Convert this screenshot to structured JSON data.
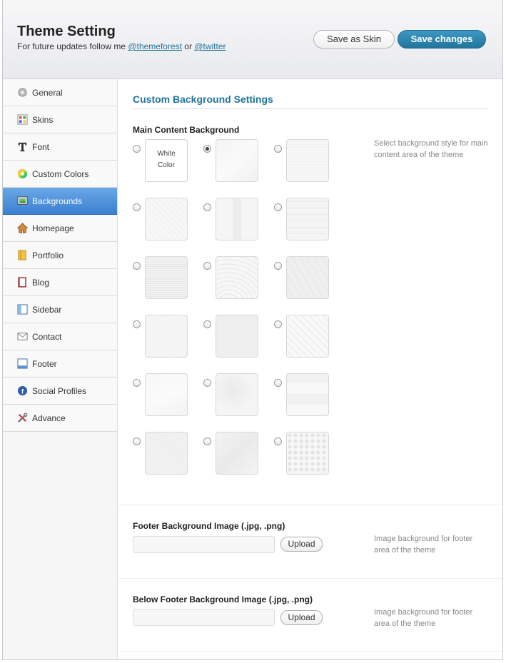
{
  "header": {
    "title": "Theme Setting",
    "subtitle_prefix": "For future updates follow me ",
    "link1": "@themeforest",
    "subtitle_mid": " or ",
    "link2": "@twitter",
    "save_skin": "Save as Skin",
    "save_changes": "Save changes"
  },
  "sidebar": {
    "items": [
      {
        "label": "General",
        "icon": "gear-icon"
      },
      {
        "label": "Skins",
        "icon": "palette-grid-icon"
      },
      {
        "label": "Font",
        "icon": "font-t-icon"
      },
      {
        "label": "Custom Colors",
        "icon": "color-wheel-icon"
      },
      {
        "label": "Backgrounds",
        "icon": "image-icon"
      },
      {
        "label": "Homepage",
        "icon": "house-icon"
      },
      {
        "label": "Portfolio",
        "icon": "folder-icon"
      },
      {
        "label": "Blog",
        "icon": "book-icon"
      },
      {
        "label": "Sidebar",
        "icon": "sidebar-icon"
      },
      {
        "label": "Contact",
        "icon": "envelope-icon"
      },
      {
        "label": "Footer",
        "icon": "footer-icon"
      },
      {
        "label": "Social Profiles",
        "icon": "social-icon"
      },
      {
        "label": "Advance",
        "icon": "tools-icon"
      }
    ],
    "active": "Backgrounds",
    "accent": "#3a7fd1"
  },
  "main": {
    "section_title": "Custom Background Settings",
    "main_bg": {
      "label": "Main Content Background",
      "help": "Select background style for main content area of the theme",
      "white_line1": "White",
      "white_line2": "Color",
      "selected_index": 1,
      "count": 18
    },
    "footer_bg": {
      "label": "Footer Background Image (.jpg, .png)",
      "upload": "Upload",
      "help": "Image background for footer area of the theme"
    },
    "below_footer_bg": {
      "label": "Below Footer Background Image (.jpg, .png)",
      "upload": "Upload",
      "help": "Image background for footer area of the theme"
    }
  }
}
